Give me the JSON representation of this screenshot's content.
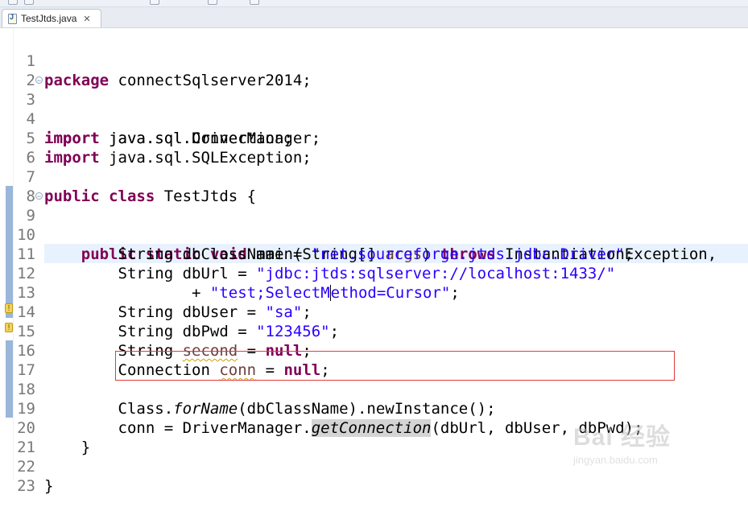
{
  "tab": {
    "filename": "TestJtds.java",
    "close_glyph": "✕"
  },
  "lines": [
    {
      "n": "1"
    },
    {
      "n": "2"
    },
    {
      "n": "3"
    },
    {
      "n": "4"
    },
    {
      "n": "5"
    },
    {
      "n": "6"
    },
    {
      "n": "7"
    },
    {
      "n": "8"
    },
    {
      "n": "9"
    },
    {
      "n": "10"
    },
    {
      "n": "11"
    },
    {
      "n": "12"
    },
    {
      "n": "13"
    },
    {
      "n": "14"
    },
    {
      "n": "15"
    },
    {
      "n": "16"
    },
    {
      "n": "17"
    },
    {
      "n": "18"
    },
    {
      "n": "19"
    },
    {
      "n": "20"
    },
    {
      "n": "21"
    },
    {
      "n": "22"
    },
    {
      "n": "23"
    }
  ],
  "code": {
    "l1": {
      "kw": "package",
      "rest": " connectSqlserver2014;"
    },
    "l3": {
      "kw": "import",
      "rest": " java.sql.Connection;"
    },
    "l4": {
      "kw": "import",
      "rest": " java.sql.DriverManager;"
    },
    "l5": {
      "kw": "import",
      "rest": " java.sql.SQLException;"
    },
    "l7": {
      "kw1": "public",
      "kw2": "class",
      "rest": " TestJtds {"
    },
    "l9": {
      "kw1": "public",
      "kw2": "static",
      "kw3": "void",
      "mid": " main(String[] ",
      "param": "args",
      "close": ") ",
      "kw4": "throws",
      "rest": " InstantiationException,"
    },
    "l10": {
      "pre": "String dbClassName = ",
      "str": "\"net.sourceforge.jtds.jdbc.Driver\"",
      "post": ";"
    },
    "l11": {
      "pre": "String dbUrl = ",
      "str": "\"jdbc:jtds:sqlserver://localhost:1433/\""
    },
    "l12": {
      "pre": "+ ",
      "str_a": "\"test;SelectM",
      "str_b": "ethod=Cursor\"",
      "post": ";"
    },
    "l13": {
      "pre": "String dbUser = ",
      "str": "\"sa\"",
      "post": ";"
    },
    "l14": {
      "pre": "String dbPwd = ",
      "str": "\"123456\"",
      "post": ";"
    },
    "l15": {
      "pre": "String ",
      "var": "second",
      "mid": " = ",
      "kw": "null",
      "post": ";"
    },
    "l16": {
      "pre": "Connection ",
      "var": "conn",
      "mid": " = ",
      "kw": "null",
      "post": ";"
    },
    "l18": {
      "pre": "Class.",
      "method": "forName",
      "post": "(dbClassName).newInstance();"
    },
    "l19": {
      "pre": "conn = DriverManager.",
      "method": "getConnection",
      "post": "(dbUrl, dbUser, dbPwd);"
    },
    "l20": {
      "text": "}"
    },
    "l22": {
      "text": "}"
    }
  },
  "watermark": {
    "big": "Bai 经验",
    "small": "jingyan.baidu.com"
  },
  "colors": {
    "keyword": "#7f0055",
    "string": "#2a00ff",
    "current_line": "#e8f2fe",
    "highlight_box": "#e23a3a"
  }
}
